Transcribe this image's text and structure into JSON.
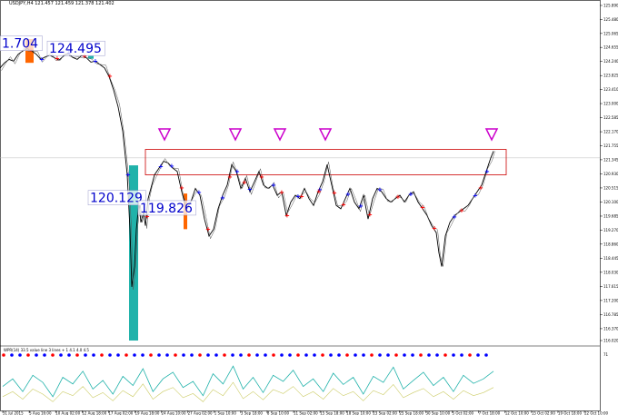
{
  "header": {
    "symbol_line": "USDJPY,H4 121.457 121.459 121.378 121.402"
  },
  "indicator_header": "WPR(14) 33.5 value line 3 lines + 1 4.1 4.0 4.5",
  "colors": {
    "price": "#000000",
    "up_marker": "#0000ff",
    "down_marker": "#ff0000",
    "teal_bar": "#20b2aa",
    "orange_bar": "#ff6600",
    "box": "#cc0000",
    "triangle": "#cc00cc",
    "label": "#0000cc",
    "ind_teal": "#20b2aa",
    "ind_yellow": "#cccc66"
  },
  "chart_data": {
    "type": "line",
    "title": "",
    "xlabel": "",
    "ylabel": "",
    "ylim": [
      116.02,
      125.89
    ],
    "y_ticks": [
      "125.890",
      "125.480",
      "125.065",
      "124.655",
      "124.240",
      "123.825",
      "123.410",
      "123.000",
      "122.585",
      "122.170",
      "121.755",
      "121.345",
      "120.930",
      "120.515",
      "120.100",
      "119.685",
      "119.270",
      "118.860",
      "118.445",
      "118.030",
      "117.615",
      "117.200",
      "116.785",
      "116.370",
      "116.020"
    ],
    "x_ticks": [
      "31 Jul 2015",
      "5 Aug 16:00",
      "10 Aug 02:00",
      "12 Aug 18:00",
      "17 Aug 02:00",
      "19 Aug 18:00",
      "24 Aug 10:00",
      "27 Aug 02:00",
      "1 Sep 10:00",
      "3 Sep 18:00",
      "8 Sep 10:00",
      "11 Sep 02:00",
      "15 Sep 18:00",
      "18 Sep 10:00",
      "23 Sep 02:00",
      "25 Sep 18:00",
      "30 Sep 10:00",
      "5 Oct 02:00",
      "7 Oct 18:00",
      "12 Oct 10:00",
      "15 Oct 02:00",
      "19 Oct 18:00",
      "22 Oct 10:00"
    ],
    "price_points": [
      [
        0,
        124.05
      ],
      [
        5,
        124.2
      ],
      [
        10,
        124.3
      ],
      [
        15,
        124.25
      ],
      [
        20,
        124.45
      ],
      [
        25,
        124.55
      ],
      [
        30,
        124.62
      ],
      [
        35,
        124.55
      ],
      [
        40,
        124.45
      ],
      [
        45,
        124.3
      ],
      [
        50,
        124.38
      ],
      [
        55,
        124.42
      ],
      [
        60,
        124.35
      ],
      [
        65,
        124.28
      ],
      [
        70,
        124.4
      ],
      [
        75,
        124.48
      ],
      [
        80,
        124.36
      ],
      [
        85,
        124.3
      ],
      [
        90,
        124.42
      ],
      [
        95,
        124.35
      ],
      [
        100,
        124.22
      ],
      [
        105,
        124.25
      ],
      [
        110,
        124.15
      ],
      [
        115,
        124.05
      ],
      [
        120,
        123.8
      ],
      [
        125,
        123.4
      ],
      [
        130,
        122.9
      ],
      [
        135,
        122.2
      ],
      [
        140,
        120.9
      ],
      [
        143,
        119.3
      ],
      [
        145,
        117.6
      ],
      [
        148,
        118.2
      ],
      [
        150,
        119.3
      ],
      [
        153,
        120.1
      ],
      [
        155,
        119.5
      ],
      [
        158,
        119.8
      ],
      [
        160,
        119.4
      ],
      [
        163,
        120.2
      ],
      [
        166,
        120.5
      ],
      [
        170,
        120.9
      ],
      [
        175,
        121.1
      ],
      [
        180,
        121.3
      ],
      [
        185,
        121.25
      ],
      [
        190,
        121.1
      ],
      [
        195,
        121.0
      ],
      [
        200,
        120.4
      ],
      [
        205,
        119.9
      ],
      [
        210,
        120.1
      ],
      [
        215,
        120.5
      ],
      [
        220,
        120.3
      ],
      [
        225,
        119.6
      ],
      [
        230,
        119.1
      ],
      [
        235,
        119.3
      ],
      [
        240,
        119.9
      ],
      [
        245,
        120.3
      ],
      [
        250,
        120.6
      ],
      [
        255,
        121.2
      ],
      [
        260,
        121.0
      ],
      [
        265,
        120.5
      ],
      [
        270,
        120.8
      ],
      [
        275,
        120.4
      ],
      [
        280,
        120.7
      ],
      [
        285,
        121.0
      ],
      [
        290,
        120.6
      ],
      [
        295,
        120.5
      ],
      [
        300,
        120.6
      ],
      [
        305,
        120.3
      ],
      [
        310,
        120.4
      ],
      [
        315,
        119.7
      ],
      [
        320,
        120.1
      ],
      [
        325,
        120.3
      ],
      [
        330,
        120.2
      ],
      [
        335,
        120.5
      ],
      [
        340,
        120.2
      ],
      [
        345,
        120.0
      ],
      [
        350,
        120.4
      ],
      [
        355,
        120.7
      ],
      [
        360,
        121.2
      ],
      [
        365,
        120.6
      ],
      [
        370,
        120.0
      ],
      [
        375,
        119.9
      ],
      [
        380,
        120.2
      ],
      [
        385,
        120.5
      ],
      [
        390,
        120.1
      ],
      [
        395,
        119.9
      ],
      [
        400,
        120.3
      ],
      [
        405,
        119.6
      ],
      [
        410,
        120.2
      ],
      [
        415,
        120.5
      ],
      [
        420,
        120.4
      ],
      [
        425,
        120.2
      ],
      [
        430,
        120.1
      ],
      [
        435,
        120.2
      ],
      [
        440,
        120.3
      ],
      [
        445,
        120.1
      ],
      [
        450,
        120.3
      ],
      [
        455,
        120.4
      ],
      [
        460,
        120.1
      ],
      [
        465,
        119.9
      ],
      [
        470,
        119.7
      ],
      [
        475,
        119.4
      ],
      [
        480,
        119.2
      ],
      [
        483,
        118.6
      ],
      [
        486,
        118.2
      ],
      [
        490,
        119.1
      ],
      [
        495,
        119.5
      ],
      [
        500,
        119.7
      ],
      [
        505,
        119.8
      ],
      [
        510,
        119.9
      ],
      [
        515,
        120.0
      ],
      [
        520,
        120.2
      ],
      [
        525,
        120.4
      ],
      [
        530,
        120.6
      ],
      [
        535,
        121.0
      ],
      [
        540,
        121.4
      ],
      [
        543,
        121.6
      ]
    ],
    "buy_markers_x": [
      45,
      75,
      104,
      140,
      176,
      188,
      218,
      244,
      260,
      274,
      300,
      327,
      351,
      382,
      396,
      417,
      451,
      499,
      522,
      535
    ],
    "sell_markers_x": [
      33,
      62,
      92,
      120,
      161,
      199,
      228,
      252,
      268,
      287,
      309,
      315,
      331,
      350,
      367,
      377,
      406,
      437,
      464,
      477,
      507,
      528
    ],
    "resistance_box": {
      "y_top": 121.65,
      "y_bottom": 120.9,
      "x_start": 160,
      "x_end": 557
    },
    "triangle_markers_x": [
      181,
      259,
      308,
      358,
      541
    ],
    "value_labels": [
      {
        "text": "1.704",
        "x": 0,
        "y": 124.75
      },
      {
        "text": "124.495",
        "x": 52,
        "y": 124.6
      },
      {
        "text": "120.129",
        "x": 97,
        "y": 120.2
      },
      {
        "text": "119.826",
        "x": 152,
        "y": 119.9
      }
    ],
    "teal_bars": [
      {
        "x": 142,
        "y_top": 121.18,
        "y_bottom": 116.02
      },
      {
        "x": 97,
        "y_top": 124.4,
        "y_bottom": 124.45
      }
    ],
    "orange_bars": [
      {
        "x": 28,
        "y_top": 124.9,
        "y_bottom": 124.2
      },
      {
        "x": 202,
        "y_top": 120.35,
        "y_bottom": 119.3
      }
    ],
    "indicator": {
      "ylim": [
        0,
        100
      ],
      "tick": "71",
      "teal": [
        40,
        55,
        30,
        62,
        48,
        20,
        58,
        45,
        70,
        35,
        52,
        25,
        60,
        42,
        75,
        30,
        55,
        68,
        38,
        50,
        22,
        65,
        45,
        80,
        35,
        58,
        28,
        62,
        50,
        72,
        40,
        55,
        30,
        66,
        44,
        58,
        25,
        60,
        48,
        78,
        35,
        52,
        68,
        42,
        58,
        30,
        62,
        46,
        55,
        70
      ],
      "yellow": [
        20,
        30,
        15,
        35,
        25,
        10,
        30,
        22,
        40,
        18,
        28,
        12,
        32,
        20,
        45,
        15,
        30,
        38,
        18,
        26,
        10,
        34,
        22,
        48,
        16,
        30,
        14,
        34,
        26,
        40,
        20,
        30,
        15,
        36,
        22,
        30,
        12,
        32,
        24,
        44,
        18,
        28,
        36,
        20,
        30,
        15,
        32,
        22,
        28,
        38
      ]
    }
  }
}
